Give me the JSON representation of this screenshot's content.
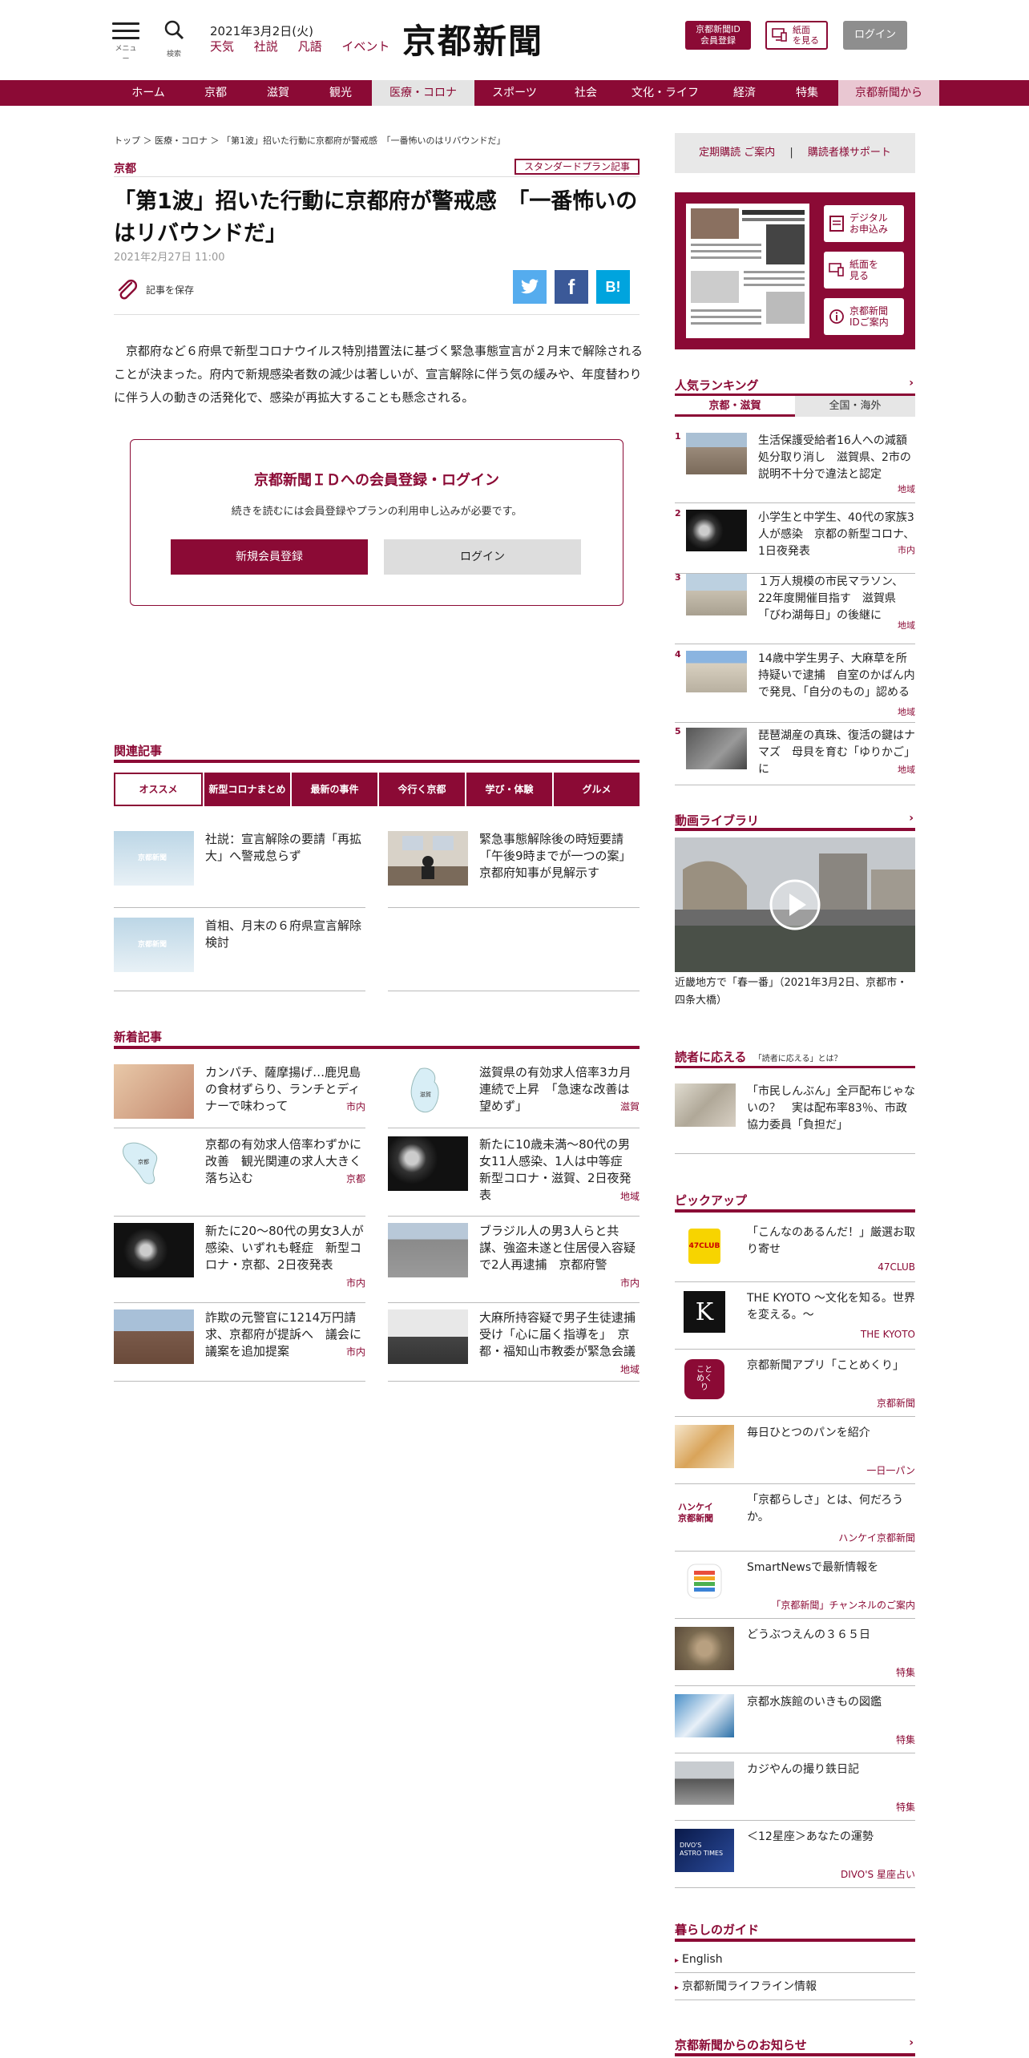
{
  "header": {
    "menu_label": "メニュー",
    "search_label": "検索",
    "date": "2021年3月2日(火)",
    "links": [
      "天気",
      "社説",
      "凡語",
      "イベント"
    ],
    "logo": "京都新聞",
    "member_button": "京都新聞ID\n会員登録",
    "paper_button": "紙面\nを見る",
    "login_button": "ログイン"
  },
  "nav": {
    "items": [
      "ホーム",
      "京都",
      "滋賀",
      "観光",
      "医療・コロナ",
      "スポーツ",
      "社会",
      "文化・ライフ",
      "経済",
      "特集",
      "京都新聞から"
    ],
    "active": "医療・コロナ"
  },
  "article": {
    "breadcrumb": "トップ ＞ 医療・コロナ ＞ 「第1波」招いた行動に京都府が警戒感　「一番怖いのはリバウンドだ」",
    "category": "京都",
    "plan_badge": "スタンダードプラン記事",
    "title": "「第1波」招いた行動に京都府が警戒感　「一番怖いのはリバウンドだ」",
    "date": "2021年2月27日 11:00",
    "save_label": "記事を保存",
    "share": {
      "twitter": "t",
      "facebook": "f",
      "hatena": "B!"
    },
    "lead": "京都府など６府県で新型コロナウイルス特別措置法に基づく緊急事態宣言が２月末で解除されることが決まった。府内で新規感染者数の減少は著しいが、宣言解除に伴う気の緩みや、年度替わりに伴う人の動きの活発化で、感染が再拡大することも懸念される。"
  },
  "login_box": {
    "title": "京都新聞ＩＤへの会員登録・ログイン",
    "text": "続きを読むには会員登録やプランの利用申し込みが必要です。",
    "register": "新規会員登録",
    "login": "ログイン"
  },
  "related": {
    "heading": "関連記事",
    "tabs": [
      "オススメ",
      "新型コロナまとめ",
      "最新の事件",
      "今行く京都",
      "学び・体験",
      "グルメ"
    ],
    "items": [
      {
        "text": "社説：宣言解除の要請「再拡大」へ警戒怠らず"
      },
      {
        "text": "緊急事態解除後の時短要請「午後9時までが一つの案」　京都府知事が見解示す"
      },
      {
        "text": "首相、月末の６府県宣言解除検討"
      }
    ],
    "placeholder_logo": "京都新聞"
  },
  "latest": {
    "heading": "新着記事",
    "items": [
      {
        "text": "カンパチ、薩摩揚げ…鹿児島の食材ずらり、ランチとディナーで味わって",
        "tag": "市内"
      },
      {
        "text": "滋賀県の有効求人倍率3カ月連続で上昇　「急速な改善は望めず」",
        "tag": "滋賀"
      },
      {
        "text": "京都の有効求人倍率わずかに改善　観光関連の求人大きく落ち込む",
        "tag": "京都"
      },
      {
        "text": "新たに10歳未満～80代の男女11人感染、1人は中等症　新型コロナ・滋賀、2日夜発表",
        "tag": "地域"
      },
      {
        "text": "新たに20～80代の男女3人が感染、いずれも軽症　新型コロナ・京都、2日夜発表",
        "tag": "市内"
      },
      {
        "text": "ブラジル人の男3人らと共謀、強盗未遂と住居侵入容疑で2人再逮捕　京都府警",
        "tag": "市内"
      },
      {
        "text": "詐欺の元警官に1214万円請求、京都府が提訴へ　議会に議案を追加提案",
        "tag": "市内"
      },
      {
        "text": "大麻所持容疑で男子生徒逮捕受け「心に届く指導を」　京都・福知山市教委が緊急会議",
        "tag": "地域"
      }
    ],
    "map_labels": [
      "滋賀",
      "京都"
    ]
  },
  "sidebar": {
    "links": [
      "定期購読 ご案内",
      "購読者様サポート"
    ],
    "paper_buttons": [
      "デジタル\nお申込み",
      "紙面を\n見る",
      "京都新聞\nIDご案内"
    ],
    "ranking": {
      "heading": "人気ランキング",
      "tab_local": "京都・滋賀",
      "tab_world": "全国・海外",
      "items": [
        {
          "num": "1",
          "text": "生活保護受給者16人への減額処分取り消し　滋賀県、2市の説明不十分で違法と認定",
          "tag": "地域"
        },
        {
          "num": "2",
          "text": "小学生と中学生、40代の家族3人が感染　京都の新型コロナ、1日夜発表",
          "tag": "市内"
        },
        {
          "num": "3",
          "text": "１万人規模の市民マラソン、22年度開催目指す　滋賀県「びわ湖毎日」の後継に",
          "tag": "地域"
        },
        {
          "num": "4",
          "text": "14歳中学生男子、大麻草を所持疑いで逮捕　自室のかばん内で発見、「自分のもの」認める",
          "tag": "地域"
        },
        {
          "num": "5",
          "text": "琵琶湖産の真珠、復活の鍵はナマズ　母貝を育む「ゆりかご」に",
          "tag": "地域"
        }
      ]
    },
    "video": {
      "heading": "動画ライブラリ",
      "caption": "近畿地方で「春一番」（2021年3月2日、京都市・四条大橋）"
    },
    "reader": {
      "heading": "読者に応える",
      "sub": "「読者に応える」とは？",
      "item": "「市民しんぶん」全戸配布じゃないの？　実は配布率83％、市政協力委員「負担だ」"
    },
    "pickup": {
      "heading": "ピックアップ",
      "items": [
        {
          "text": "「こんなのあるんだ！」厳選お取り寄せ",
          "tag": "47CLUB"
        },
        {
          "text": "THE KYOTO ～文化を知る。世界を変える。～",
          "tag": "THE KYOTO"
        },
        {
          "text": "京都新聞アプリ「ことめくり」",
          "tag": "京都新聞"
        },
        {
          "text": "毎日ひとつのパンを紹介",
          "tag": "一日一パン"
        },
        {
          "text": "「京都らしさ」とは、何だろうか。",
          "tag": "ハンケイ京都新聞"
        },
        {
          "text": "SmartNewsで最新情報を",
          "tag": "「京都新聞」チャンネルのご案内"
        },
        {
          "text": "どうぶつえんの３６５日",
          "tag": "特集"
        },
        {
          "text": "京都水族館のいきもの図鑑",
          "tag": "特集"
        },
        {
          "text": "カジやんの撮り鉄日記",
          "tag": "特集"
        },
        {
          "text": "＜12星座＞あなたの運勢",
          "tag": "DIVO'S 星座占い"
        }
      ],
      "logo_47": "47CLUB",
      "logo_k": "K",
      "logo_kotomekuri": "こと\nめく\nり",
      "logo_hankei": "ハンケイ\n京都新聞",
      "logo_divo": "DIVO'S\nASTRO TIMES"
    },
    "guide": {
      "heading": "暮らしのガイド",
      "items": [
        "English",
        "京都新聞ライフライン情報"
      ]
    },
    "notice": {
      "heading": "京都新聞からのお知らせ"
    }
  },
  "colors": {
    "brand": "#8b0a35",
    "nav_active_bg": "#e4e4e4",
    "nav_pink_bg": "#e9c7d2"
  }
}
